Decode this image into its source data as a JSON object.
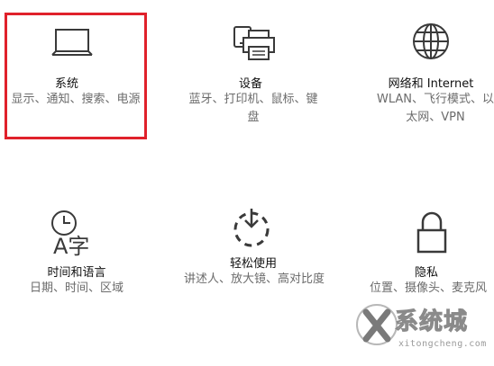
{
  "tiles": {
    "system": {
      "title": "系统",
      "desc": "显示、通知、搜索、电源"
    },
    "devices": {
      "title": "设备",
      "desc": "蓝牙、打印机、鼠标、键盘"
    },
    "network": {
      "title": "网络和 Internet",
      "desc_line1": "WLAN、飞行模式、以",
      "desc_line2": "太网、VPN"
    },
    "time": {
      "title": "时间和语言",
      "desc": "日期、时间、区域"
    },
    "ease": {
      "title": "轻松使用",
      "desc": "讲述人、放大镜、高对比度"
    },
    "privacy": {
      "title": "隐私",
      "desc": "位置、摄像头、麦克风"
    }
  },
  "time_icon_glyph": "A字",
  "watermark": {
    "text": "系统城",
    "url": "xitongcheng.com"
  },
  "colors": {
    "highlight": "#e0212b",
    "icon": "#3a3a3a",
    "desc": "#6b6b6b"
  }
}
